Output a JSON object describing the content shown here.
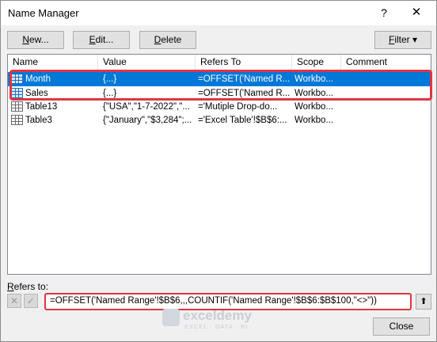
{
  "window": {
    "title": "Name Manager",
    "help_glyph": "?",
    "close_glyph": "✕"
  },
  "toolbar": {
    "new_label_u": "N",
    "new_label_rest": "ew...",
    "edit_label_u": "E",
    "edit_label_rest": "dit...",
    "delete_label_u": "D",
    "delete_label_rest": "elete",
    "filter_label_u": "F",
    "filter_label_rest": "ilter ▾"
  },
  "list": {
    "columns": [
      "Name",
      "Value",
      "Refers To",
      "Scope",
      "Comment"
    ],
    "rows": [
      {
        "name": "Month",
        "value": "{...}",
        "refers_to": "=OFFSET('Named R...",
        "scope": "Workbo...",
        "comment": "",
        "selected": true
      },
      {
        "name": "Sales",
        "value": "{...}",
        "refers_to": "=OFFSET('Named R...",
        "scope": "Workbo...",
        "comment": "",
        "selected": false
      },
      {
        "name": "Table13",
        "value": "{\"USA\",\"1-7-2022\",\"...",
        "refers_to": "='Mutiple Drop-do...",
        "scope": "Workbo...",
        "comment": "",
        "selected": false
      },
      {
        "name": "Table3",
        "value": "{\"January\",\"$3,284\";...",
        "refers_to": "='Excel Table'!$B$6:...",
        "scope": "Workbo...",
        "comment": "",
        "selected": false
      }
    ]
  },
  "refers": {
    "label_u": "R",
    "label_rest": "efers to:",
    "value": "=OFFSET('Named Range'!$B$6,,,COUNTIF('Named Range'!$B$6:$B$100,\"<>\"))",
    "cancel_glyph": "✕",
    "accept_glyph": "✓",
    "collapse_glyph": "⬆"
  },
  "footer": {
    "close_label": "Close"
  },
  "watermark": {
    "name": "exceldemy",
    "sub": "EXCEL · DATA · BI"
  }
}
